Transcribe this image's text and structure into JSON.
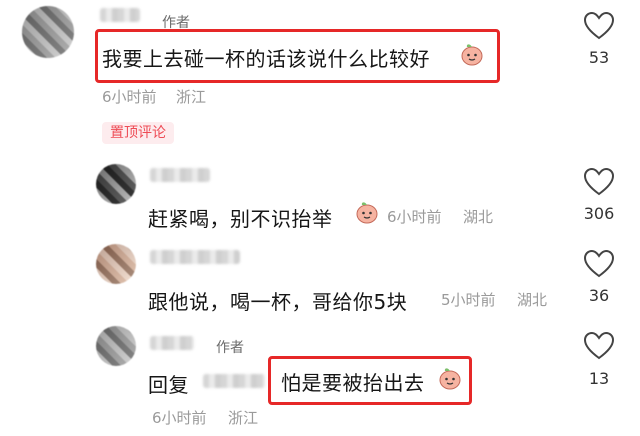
{
  "main_comment": {
    "author_tag": "作者",
    "text": "我要上去碰一杯的话该说什么比较好",
    "time": "6小时前",
    "location": "浙江",
    "likes": "53"
  },
  "pinned_label": "置顶评论",
  "replies": [
    {
      "text": "赶紧喝，别不识抬举",
      "time": "6小时前",
      "location": "湖北",
      "likes": "306"
    },
    {
      "text": "跟他说，喝一杯，哥给你5块",
      "time": "5小时前",
      "location": "湖北",
      "likes": "36"
    },
    {
      "author_tag": "作者",
      "prefix": "回复",
      "text": "怕是要被抬出去",
      "time": "6小时前",
      "location": "浙江",
      "likes": "13"
    }
  ],
  "colors": {
    "highlight_border": "#e62828",
    "pin_text": "#ee4b55",
    "pin_bg": "#fdecee"
  },
  "icons": [
    "heart-icon",
    "peach-emoji-icon"
  ]
}
